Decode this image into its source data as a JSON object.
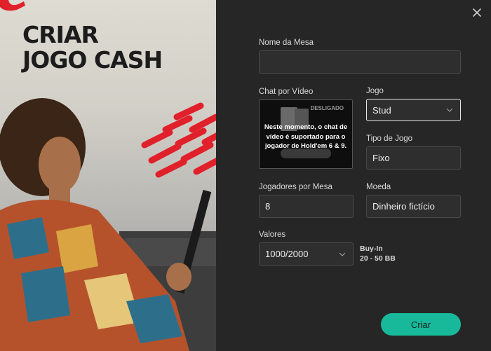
{
  "hero": {
    "title_line1": "CRIAR",
    "title_line2": "JOGO CASH"
  },
  "form": {
    "table_name": {
      "label": "Nome da Mesa",
      "value": ""
    },
    "video_chat": {
      "label": "Chat por Vídeo",
      "status_badge": "DESLIGADO",
      "message": "Neste momento, o chat de vídeo é suportado para o jogador de Hold'em 6 & 9."
    },
    "game": {
      "label": "Jogo",
      "value": "Stud"
    },
    "game_type": {
      "label": "Tipo de Jogo",
      "value": "Fixo"
    },
    "players_per_table": {
      "label": "Jogadores por Mesa",
      "value": "8"
    },
    "currency": {
      "label": "Moeda",
      "value": "Dinheiro fictício"
    },
    "stakes": {
      "label": "Valores",
      "value": "1000/2000"
    },
    "buyin": {
      "label": "Buy-In",
      "value": "20 - 50 BB"
    },
    "create_button": "Criar"
  },
  "colors": {
    "accent": "#18b99a",
    "panel_bg": "#262626",
    "field_bg": "#2e2e2e",
    "brand_red": "#e0202a"
  },
  "icons": {
    "close": "close-icon",
    "dropdown": "chevron-down-icon",
    "ribbon": "red-ribbon-icon"
  }
}
